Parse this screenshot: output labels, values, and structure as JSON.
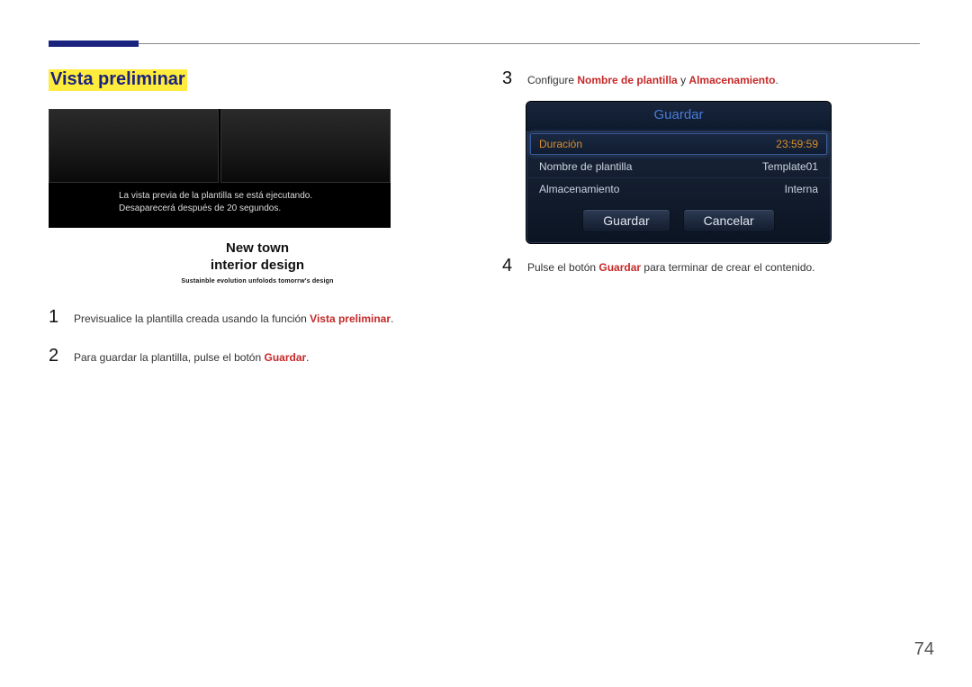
{
  "page_number": "74",
  "left": {
    "heading": "Vista preliminar",
    "preview_msg_line1": "La vista previa de la plantilla se está ejecutando.",
    "preview_msg_line2": "Desaparecerá después de 20 segundos.",
    "caption_line1": "New town",
    "caption_line2": "interior design",
    "caption_line3": "Sustainble evolution unfolods tomorrw's design",
    "step1_num": "1",
    "step1_a": "Previsualice la plantilla creada usando la función ",
    "step1_kw": "Vista preliminar",
    "step1_b": ".",
    "step2_num": "2",
    "step2_a": "Para guardar la plantilla, pulse el botón ",
    "step2_kw": "Guardar",
    "step2_b": "."
  },
  "right": {
    "step3_num": "3",
    "step3_a": "Configure ",
    "step3_kw1": "Nombre de plantilla",
    "step3_mid": " y ",
    "step3_kw2": "Almacenamiento",
    "step3_b": ".",
    "dialog_title": "Guardar",
    "row1_label": "Duración",
    "row1_value": "23:59:59",
    "row2_label": "Nombre de plantilla",
    "row2_value": "Template01",
    "row3_label": "Almacenamiento",
    "row3_value": "Interna",
    "btn_save": "Guardar",
    "btn_cancel": "Cancelar",
    "step4_num": "4",
    "step4_a": "Pulse el botón ",
    "step4_kw": "Guardar",
    "step4_b": " para terminar de crear el contenido."
  }
}
